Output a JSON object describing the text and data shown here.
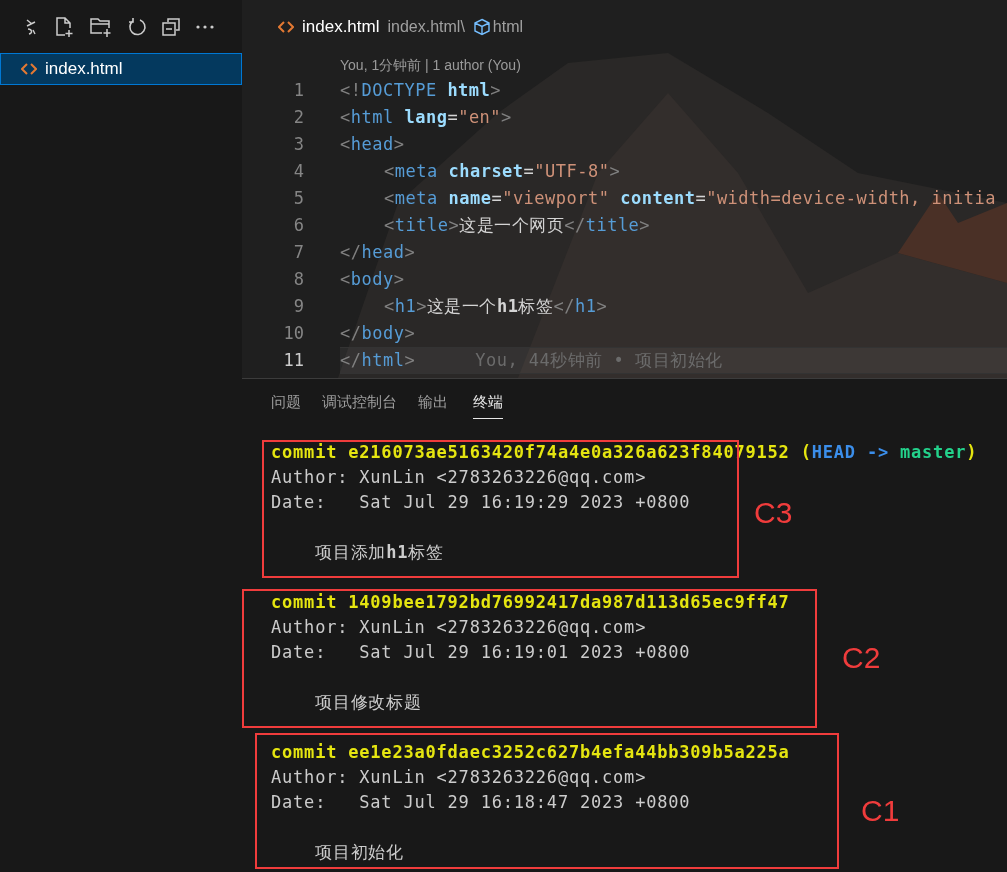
{
  "sidebar": {
    "files": [
      {
        "name": "index.html",
        "selected": true
      }
    ]
  },
  "editor": {
    "tab": {
      "label": "index.html"
    },
    "breadcrumb": {
      "file": "index.html\\",
      "symbol": "html"
    },
    "blame_header": "You, 1分钟前 | 1 author (You)",
    "lines": [
      {
        "number": "1",
        "current": false,
        "indented": false,
        "tokens": [
          {
            "kind": "punct",
            "text": "<!"
          },
          {
            "kind": "tag",
            "text": "DOCTYPE"
          },
          {
            "kind": "attr",
            "text": " html"
          },
          {
            "kind": "punct",
            "text": ">"
          }
        ]
      },
      {
        "number": "2",
        "current": false,
        "indented": false,
        "tokens": [
          {
            "kind": "punct",
            "text": "<"
          },
          {
            "kind": "tag",
            "text": "html"
          },
          {
            "kind": "attr",
            "text": " lang"
          },
          {
            "kind": "text",
            "text": "="
          },
          {
            "kind": "string",
            "text": "\"en\""
          },
          {
            "kind": "punct",
            "text": ">"
          }
        ]
      },
      {
        "number": "3",
        "current": false,
        "indented": false,
        "tokens": [
          {
            "kind": "punct",
            "text": "<"
          },
          {
            "kind": "tag",
            "text": "head"
          },
          {
            "kind": "punct",
            "text": ">"
          }
        ]
      },
      {
        "number": "4",
        "current": false,
        "indented": true,
        "tokens": [
          {
            "kind": "punct",
            "text": "<"
          },
          {
            "kind": "tag",
            "text": "meta"
          },
          {
            "kind": "attr",
            "text": " charset"
          },
          {
            "kind": "text",
            "text": "="
          },
          {
            "kind": "string",
            "text": "\"UTF-8\""
          },
          {
            "kind": "punct",
            "text": ">"
          }
        ]
      },
      {
        "number": "5",
        "current": false,
        "indented": true,
        "tokens": [
          {
            "kind": "punct",
            "text": "<"
          },
          {
            "kind": "tag",
            "text": "meta"
          },
          {
            "kind": "attr",
            "text": " name"
          },
          {
            "kind": "text",
            "text": "="
          },
          {
            "kind": "string",
            "text": "\"viewport\""
          },
          {
            "kind": "attr",
            "text": " content"
          },
          {
            "kind": "text",
            "text": "="
          },
          {
            "kind": "string",
            "text": "\"width=device-width, initia"
          }
        ]
      },
      {
        "number": "6",
        "current": false,
        "indented": true,
        "tokens": [
          {
            "kind": "punct",
            "text": "<"
          },
          {
            "kind": "tag",
            "text": "title"
          },
          {
            "kind": "punct",
            "text": ">"
          },
          {
            "kind": "text",
            "text": "这是一个网页"
          },
          {
            "kind": "punct",
            "text": "</"
          },
          {
            "kind": "tag",
            "text": "title"
          },
          {
            "kind": "punct",
            "text": ">"
          }
        ]
      },
      {
        "number": "7",
        "current": false,
        "indented": false,
        "tokens": [
          {
            "kind": "punct",
            "text": "</"
          },
          {
            "kind": "tag",
            "text": "head"
          },
          {
            "kind": "punct",
            "text": ">"
          }
        ]
      },
      {
        "number": "8",
        "current": false,
        "indented": false,
        "tokens": [
          {
            "kind": "punct",
            "text": "<"
          },
          {
            "kind": "tag",
            "text": "body"
          },
          {
            "kind": "punct",
            "text": ">"
          }
        ]
      },
      {
        "number": "9",
        "current": false,
        "indented": true,
        "tokens": [
          {
            "kind": "punct",
            "text": "<"
          },
          {
            "kind": "tag",
            "text": "h1"
          },
          {
            "kind": "punct",
            "text": ">"
          },
          {
            "kind": "text",
            "text": "这是一个**h1**标签"
          },
          {
            "kind": "punct",
            "text": "</"
          },
          {
            "kind": "tag",
            "text": "h1"
          },
          {
            "kind": "punct",
            "text": ">"
          }
        ]
      },
      {
        "number": "10",
        "current": false,
        "indented": false,
        "tokens": [
          {
            "kind": "punct",
            "text": "</"
          },
          {
            "kind": "tag",
            "text": "body"
          },
          {
            "kind": "punct",
            "text": ">"
          }
        ]
      },
      {
        "number": "11",
        "current": true,
        "indented": false,
        "tokens": [
          {
            "kind": "punct",
            "text": "</"
          },
          {
            "kind": "tag",
            "text": "html"
          },
          {
            "kind": "punct",
            "text": ">"
          }
        ]
      }
    ],
    "inline_blame": "You, 44秒钟前 • 项目初始化"
  },
  "panel": {
    "tabs": [
      {
        "label": "问题",
        "selected": false
      },
      {
        "label": "调试控制台",
        "selected": false
      },
      {
        "label": "输出",
        "selected": false
      },
      {
        "label": "终端",
        "selected": true
      }
    ],
    "commits": [
      {
        "hash": "commit e216073ae5163420f74a4e0a326a623f84079152",
        "refs": {
          "open": "(",
          "head": "HEAD",
          "arrow": "->",
          "branch": "master",
          "close": ")"
        },
        "author": "Author: XunLin <2783263226@qq.com>",
        "date": "Date:   Sat Jul 29 16:19:29 2023 +0800",
        "message": "项目添加**h1**标签",
        "annotation": "C3"
      },
      {
        "hash": "commit 1409bee1792bd76992417da987d113d65ec9ff47",
        "author": "Author: XunLin <2783263226@qq.com>",
        "date": "Date:   Sat Jul 29 16:19:01 2023 +0800",
        "message": "项目修改标题",
        "annotation": "C2"
      },
      {
        "hash": "commit ee1e23a0fdaec3252c627b4efa44bb309b5a225a",
        "author": "Author: XunLin <2783263226@qq.com>",
        "date": "Date:   Sat Jul 29 16:18:47 2023 +0800",
        "message": "项目初始化",
        "annotation": "C1"
      }
    ]
  }
}
